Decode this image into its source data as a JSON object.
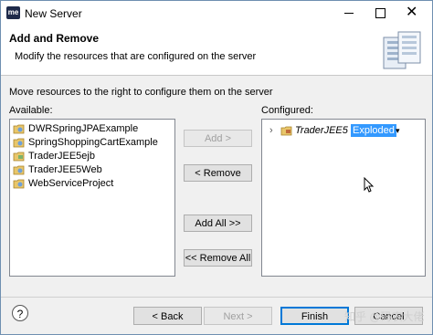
{
  "window": {
    "title": "New Server",
    "app_icon_text": "me",
    "controls": {
      "minimize": "minimize",
      "maximize": "maximize",
      "close": "✕"
    }
  },
  "header": {
    "title": "Add and Remove",
    "description": "Modify the resources that are configured on the server"
  },
  "main": {
    "instruction": "Move resources to the right to configure them on the server",
    "available_label": "Available:",
    "configured_label": "Configured:",
    "available": [
      "DWRSpringJPAExample",
      "SpringShoppingCartExample",
      "TraderJEE5ejb",
      "TraderJEE5Web",
      "WebServiceProject"
    ],
    "configured": {
      "expander": "›",
      "name": "TraderJEE5",
      "mode": "Exploded",
      "caret": "▾"
    }
  },
  "buttons": {
    "add": "Add >",
    "remove": "< Remove",
    "add_all": "Add All >>",
    "remove_all": "<< Remove All",
    "help": "?",
    "back": "< Back",
    "next": "Next >",
    "finish": "Finish",
    "cancel": "Cancel"
  },
  "watermark": "知乎 @码农大佬",
  "colors": {
    "selection": "#3399ff",
    "default_button_border": "#0078d7"
  }
}
